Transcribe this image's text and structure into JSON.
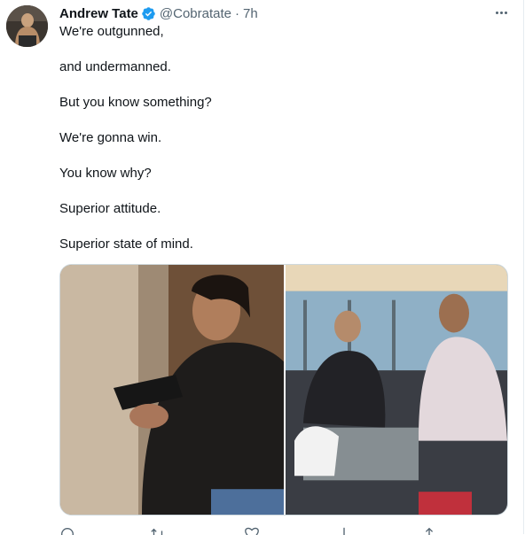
{
  "tweet": {
    "author_name": "Andrew Tate",
    "handle": "@Cobratate",
    "separator": "·",
    "time": "7h",
    "verified_color": "#1d9bf0",
    "lines": [
      "We're outgunned,",
      "and undermanned.",
      "But you know something?",
      "We're gonna win.",
      "You know why?",
      "Superior attitude.",
      "Superior state of mind."
    ]
  },
  "icons": {
    "more": "more-options-icon",
    "verified": "verified-badge-icon",
    "reply": "reply-icon",
    "retweet": "retweet-icon",
    "like": "like-icon",
    "views": "views-icon",
    "share": "share-icon"
  }
}
